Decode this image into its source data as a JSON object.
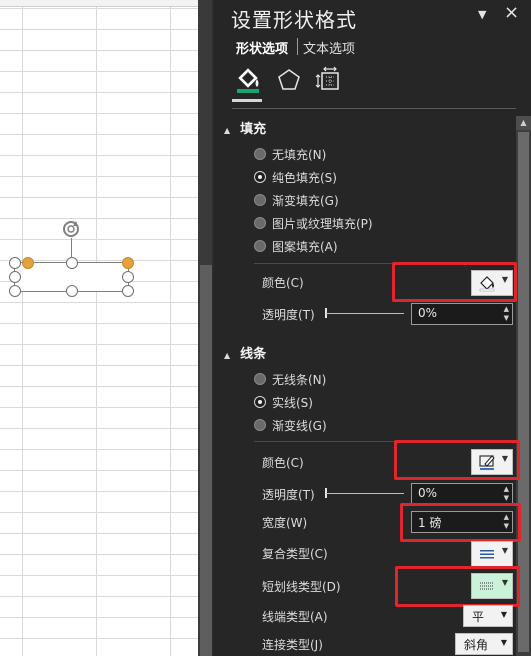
{
  "panel": {
    "title": "设置形状格式",
    "tabs": [
      "形状选项",
      "文本选项"
    ],
    "icons": [
      "fill-line-icon",
      "effects-pentagon-icon",
      "size-properties-icon"
    ]
  },
  "fill": {
    "header": "填充",
    "options": [
      {
        "label": "无填充(N)",
        "selected": false
      },
      {
        "label": "纯色填充(S)",
        "selected": true
      },
      {
        "label": "渐变填充(G)",
        "selected": false
      },
      {
        "label": "图片或纹理填充(P)",
        "selected": false
      },
      {
        "label": "图案填充(A)",
        "selected": false
      }
    ],
    "color_label": "颜色(C)",
    "transparency_label": "透明度(T)",
    "transparency_value": "0%"
  },
  "line": {
    "header": "线条",
    "options": [
      {
        "label": "无线条(N)",
        "selected": false
      },
      {
        "label": "实线(S)",
        "selected": true
      },
      {
        "label": "渐变线(G)",
        "selected": false
      }
    ],
    "color_label": "颜色(C)",
    "transparency_label": "透明度(T)",
    "transparency_value": "0%",
    "width_label": "宽度(W)",
    "width_value": "1 磅",
    "compound_label": "复合类型(C)",
    "dash_label": "短划线类型(D)",
    "cap_label": "线端类型(A)",
    "cap_value": "平",
    "join_label": "连接类型(J)",
    "join_value": "斜角"
  },
  "colors": {
    "panel_bg": "#262626",
    "highlight": "#e0262c",
    "handle_orange": "#e3a23e"
  }
}
